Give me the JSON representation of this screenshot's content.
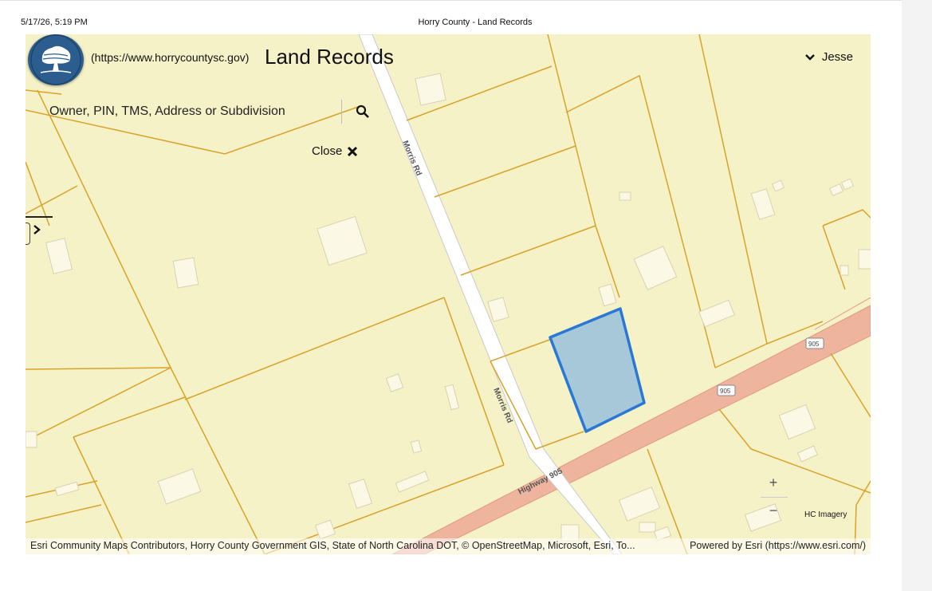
{
  "print_header": {
    "datetime": "5/17/26, 5:19 PM",
    "page_title": "Horry County - Land Records"
  },
  "app": {
    "link_text": "(https://www.horrycountysc.gov)",
    "title": "Land Records",
    "user_name": "Jesse",
    "logo_icon": "horry-county-tree-logo"
  },
  "search": {
    "placeholder": "Owner, PIN, TMS, Address or Subdivision",
    "value": "",
    "icon": "search-icon"
  },
  "close": {
    "label": "Close",
    "icon": "close-x-icon"
  },
  "map": {
    "roads": {
      "morris_upper": "Morris Rd",
      "morris_lower": "Morris Rd",
      "highway": "Highway 905",
      "shield_1": "905",
      "shield_2": "905"
    },
    "zoom_in_label": "+",
    "zoom_out_label": "−",
    "imagery_label": "HC Imagery",
    "colors": {
      "background": "#f6f2c8",
      "parcel_lines": "#d9a22a",
      "highway_fill": "#eeb49e",
      "selected_parcel_fill": "#a7c8d8",
      "selected_parcel_stroke": "#2a78d6"
    }
  },
  "attribution": {
    "sources": "Esri Community Maps Contributors, Horry County Government GIS, State of North Carolina DOT, © OpenStreetMap, Microsoft, Esri, To...",
    "powered_by": "Powered by Esri (https://www.esri.com/)"
  }
}
